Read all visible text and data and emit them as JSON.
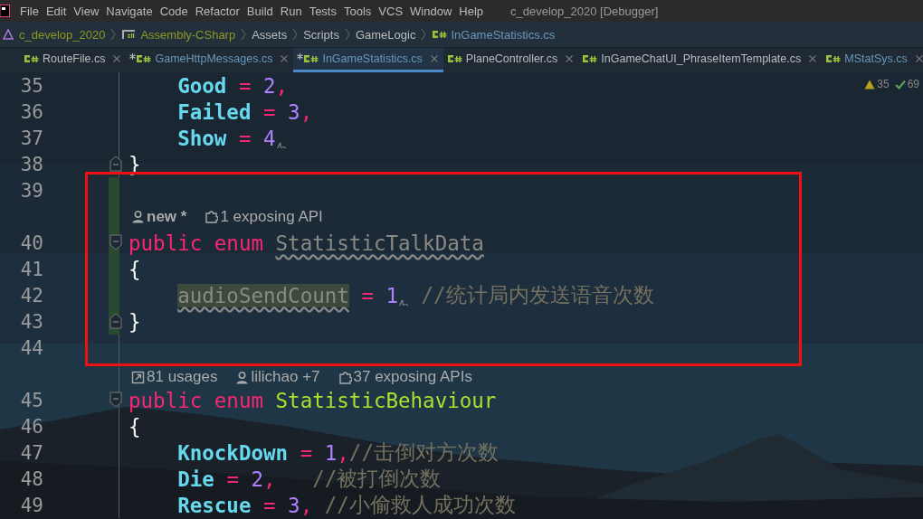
{
  "menu": {
    "items": [
      "File",
      "Edit",
      "View",
      "Navigate",
      "Code",
      "Refactor",
      "Build",
      "Run",
      "Tests",
      "Tools",
      "VCS",
      "Window",
      "Help"
    ],
    "title": "c_develop_2020 [Debugger]"
  },
  "breadcrumb": [
    {
      "kind": "project",
      "text": "c_develop_2020"
    },
    {
      "kind": "assembly",
      "text": "Assembly-CSharp"
    },
    {
      "kind": "folder",
      "text": "Assets"
    },
    {
      "kind": "folder",
      "text": "Scripts"
    },
    {
      "kind": "folder",
      "text": "GameLogic"
    },
    {
      "kind": "file",
      "text": "InGameStatistics.cs"
    }
  ],
  "tabs": [
    {
      "label": "RouteFile.cs",
      "modified": false,
      "selected": false,
      "color": "#bbbbbb"
    },
    {
      "label": "GameHttpMessages.cs",
      "modified": true,
      "selected": false,
      "color": "#6897bb"
    },
    {
      "label": "InGameStatistics.cs",
      "modified": true,
      "selected": true,
      "color": "#6897bb"
    },
    {
      "label": "PlaneController.cs",
      "modified": false,
      "selected": false,
      "color": "#bbbbbb"
    },
    {
      "label": "InGameChatUI_PhraseItemTemplate.cs",
      "modified": false,
      "selected": false,
      "color": "#bbbbbb"
    },
    {
      "label": "MStatSys.cs",
      "modified": false,
      "selected": false,
      "color": "#6897bb"
    }
  ],
  "inspection": {
    "warnings": "35",
    "passed": "69"
  },
  "lines": [
    {
      "kind": "code",
      "number": "35",
      "changed": false,
      "tokens": [
        {
          "kind": "member",
          "text": "    Good"
        },
        {
          "kind": "operator",
          "text": " = "
        },
        {
          "kind": "number",
          "text": "2"
        },
        {
          "kind": "operator",
          "text": ","
        }
      ]
    },
    {
      "kind": "code",
      "number": "36",
      "changed": false,
      "tokens": [
        {
          "kind": "member",
          "text": "    Failed"
        },
        {
          "kind": "operator",
          "text": " = "
        },
        {
          "kind": "number",
          "text": "3"
        },
        {
          "kind": "operator",
          "text": ","
        }
      ]
    },
    {
      "kind": "code",
      "number": "37",
      "changed": false,
      "tokens": [
        {
          "kind": "member",
          "text": "    Show"
        },
        {
          "kind": "operator",
          "text": " = "
        },
        {
          "kind": "number",
          "text": "4"
        },
        {
          "kind": "mark"
        }
      ]
    },
    {
      "kind": "code",
      "number": "38",
      "changed": false,
      "fold": {
        "kind": "end"
      },
      "tokens": [
        {
          "kind": "brace",
          "text": "}"
        }
      ]
    },
    {
      "kind": "code",
      "number": "39",
      "changed": true
    },
    {
      "kind": "hint",
      "changed": true,
      "items": [
        {
          "kind": "author",
          "text": "new *",
          "bold": true
        },
        {
          "kind": "api",
          "text": "1 exposing API",
          "bold": false
        }
      ]
    },
    {
      "kind": "code",
      "number": "40",
      "changed": true,
      "fold": {
        "kind": "start"
      },
      "tokens": [
        {
          "kind": "keyword",
          "text": "public enum "
        },
        {
          "kind": "unused-type",
          "text": "StatisticTalkData"
        }
      ]
    },
    {
      "kind": "code",
      "number": "41",
      "changed": true,
      "tokens": [
        {
          "kind": "brace",
          "text": "{"
        }
      ]
    },
    {
      "kind": "code",
      "number": "42",
      "changed": true,
      "tokens": [
        {
          "kind": "unused-member",
          "text": "    audioSendCount"
        },
        {
          "kind": "operator",
          "text": " = "
        },
        {
          "kind": "number",
          "text": "1"
        },
        {
          "kind": "mark"
        },
        {
          "kind": "comment",
          "text": " //统计局内发送语音次数"
        }
      ]
    },
    {
      "kind": "code",
      "number": "43",
      "changed": true,
      "fold": {
        "kind": "end"
      },
      "tokens": [
        {
          "kind": "brace",
          "text": "}"
        }
      ]
    },
    {
      "kind": "code",
      "number": "44",
      "changed": false
    },
    {
      "kind": "hint",
      "changed": false,
      "items": [
        {
          "kind": "usages",
          "text": "81 usages",
          "bold": false
        },
        {
          "kind": "author",
          "text": "lilichao +7",
          "bold": false
        },
        {
          "kind": "api",
          "text": "37 exposing APIs",
          "bold": false
        }
      ]
    },
    {
      "kind": "code",
      "number": "45",
      "changed": false,
      "fold": {
        "kind": "start"
      },
      "tokens": [
        {
          "kind": "keyword",
          "text": "public enum "
        },
        {
          "kind": "type",
          "text": "StatisticBehaviour"
        }
      ]
    },
    {
      "kind": "code",
      "number": "46",
      "changed": false,
      "tokens": [
        {
          "kind": "brace",
          "text": "{"
        }
      ]
    },
    {
      "kind": "code",
      "number": "47",
      "changed": false,
      "tokens": [
        {
          "kind": "member",
          "text": "    KnockDown"
        },
        {
          "kind": "operator",
          "text": " = "
        },
        {
          "kind": "number",
          "text": "1"
        },
        {
          "kind": "operator",
          "text": ","
        },
        {
          "kind": "comment",
          "text": "//击倒对方次数"
        }
      ]
    },
    {
      "kind": "code",
      "number": "48",
      "changed": false,
      "tokens": [
        {
          "kind": "member",
          "text": "    Die"
        },
        {
          "kind": "operator",
          "text": " = "
        },
        {
          "kind": "number",
          "text": "2"
        },
        {
          "kind": "operator",
          "text": ",  "
        },
        {
          "kind": "comment",
          "text": " //被打倒次数"
        }
      ]
    },
    {
      "kind": "code",
      "number": "49",
      "changed": false,
      "tokens": [
        {
          "kind": "member",
          "text": "    Rescue"
        },
        {
          "kind": "operator",
          "text": " = "
        },
        {
          "kind": "number",
          "text": "3"
        },
        {
          "kind": "operator",
          "text": ","
        },
        {
          "kind": "comment",
          "text": " //小偷救人成功次数"
        }
      ]
    }
  ],
  "annotation": {
    "kind": "rectangle"
  }
}
